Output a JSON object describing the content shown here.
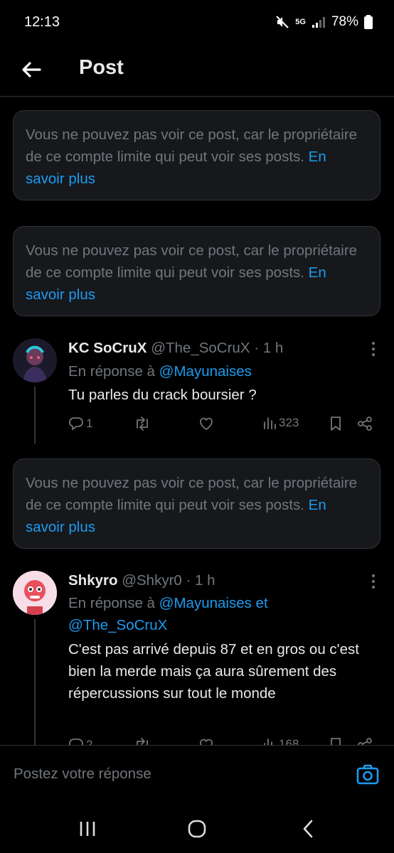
{
  "status_bar": {
    "time": "12:13",
    "network": "5G",
    "battery": "78%"
  },
  "header": {
    "title": "Post"
  },
  "restricted_notice": {
    "text": "Vous ne pouvez pas voir ce post, car le propriétaire de ce compte limite qui peut voir ses posts.",
    "link": "En savoir plus"
  },
  "tweets": [
    {
      "name": "KC SoCruX",
      "handle": "@The_SoCruX",
      "time": "· 1 h",
      "reply_prefix": "En réponse à",
      "mentions": "@Mayunaises",
      "text": "Tu parles du crack boursier ?",
      "replies": "1",
      "views": "323"
    },
    {
      "name": "Shkyro",
      "handle": "@Shkyr0",
      "time": "· 1 h",
      "reply_prefix": "En réponse à",
      "mentions_line1": "@Mayunaises et",
      "mentions_line2": "@The_SoCruX",
      "text": "C'est pas arrivé depuis 87 et en gros ou c'est bien la merde mais ça aura sûrement des répercussions sur tout le monde",
      "replies": "2",
      "views": "168"
    }
  ],
  "compose": {
    "placeholder": "Postez votre réponse"
  },
  "colors": {
    "accent": "#1d9bf0",
    "muted": "#71767b",
    "card_bg": "#16181c",
    "border": "#2f3336"
  },
  "icons": [
    "back-arrow-icon",
    "more-icon",
    "reply-icon",
    "retweet-icon",
    "like-icon",
    "views-icon",
    "bookmark-icon",
    "share-icon",
    "camera-icon",
    "recents-icon",
    "home-icon",
    "back-icon"
  ]
}
